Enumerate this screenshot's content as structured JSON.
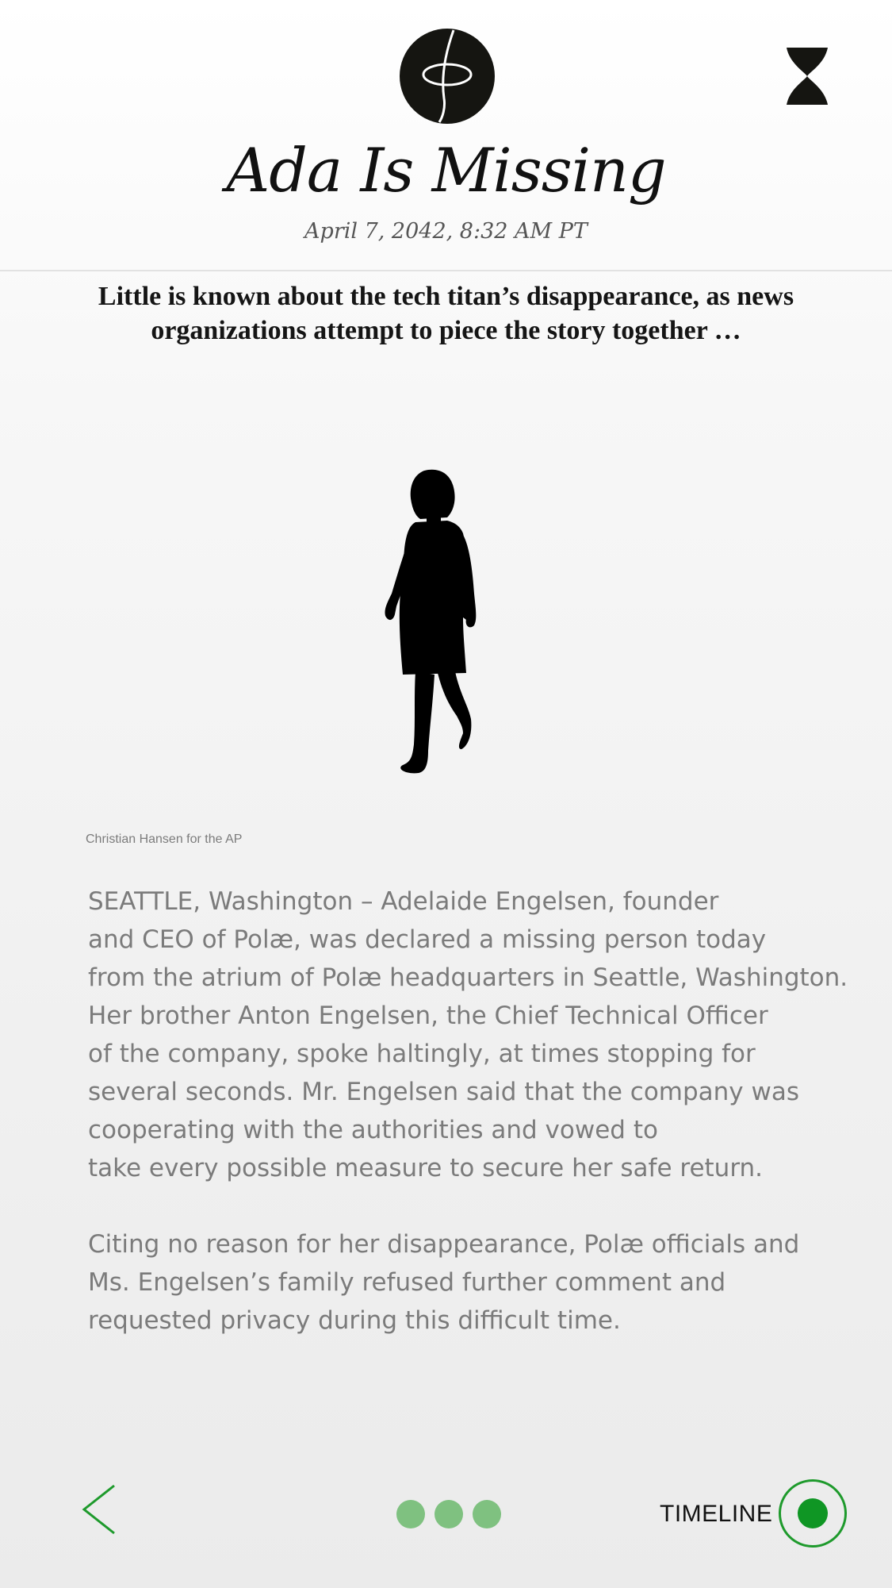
{
  "header": {
    "title": "Ada Is Missing",
    "dateline": "April 7, 2042, 8:32 AM PT"
  },
  "icons": {
    "logo": "polae-logo-icon",
    "hourglass": "hourglass-icon",
    "back": "chevron-left-icon",
    "timeline": "timeline-record-icon"
  },
  "article": {
    "dek": "Little is known about the tech titan’s disappearance, as news organizations attempt to piece the story together …",
    "photo_caption": "Christian Hansen for the AP",
    "paragraphs": [
      "SEATTLE, Washington – Adelaide Engelsen, founder\nand CEO of Polæ, was declared a missing person today\nfrom the atrium of Polæ headquarters in Seattle, Washington.\nHer brother Anton Engelsen, the Chief Technical Officer\nof the company, spoke haltingly, at times stopping for\nseveral seconds.  Mr. Engelsen said that the company was\ncooperating with the authorities  and vowed to\ntake every possible measure to secure her safe return.",
      "Citing no reason for her disappearance, Polæ officials and\nMs. Engelsen’s family refused further comment and\nrequested privacy during this difficult time."
    ]
  },
  "footer": {
    "timeline_label": "TIMELINE",
    "page_dots": 3
  },
  "colors": {
    "accent_green": "#1e9a2c",
    "dot_green": "#7fc180",
    "logo_dark": "#151511"
  }
}
